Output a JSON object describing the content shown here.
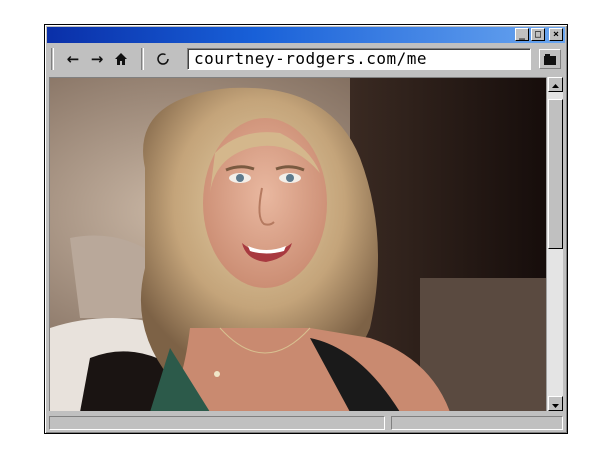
{
  "browser": {
    "address": "courtney-rodgers.com/me",
    "status_left": "",
    "status_right": ""
  },
  "titlebar": {
    "minimize_glyph": "_",
    "maximize_glyph": "□",
    "close_glyph": "×"
  },
  "toolbar": {
    "back_glyph": "←",
    "forward_glyph": "→",
    "home_glyph": "⌂",
    "refresh_glyph": "⟳"
  },
  "icons": {
    "back": "arrow-left-icon",
    "forward": "arrow-right-icon",
    "home": "home-icon",
    "refresh": "refresh-icon",
    "go": "folder-icon",
    "scroll_up": "triangle-up-icon",
    "scroll_down": "triangle-down-icon"
  },
  "colors": {
    "titlebar_start": "#0a2fa8",
    "titlebar_end": "#6aa6f0",
    "chrome": "#c0c0c0"
  }
}
